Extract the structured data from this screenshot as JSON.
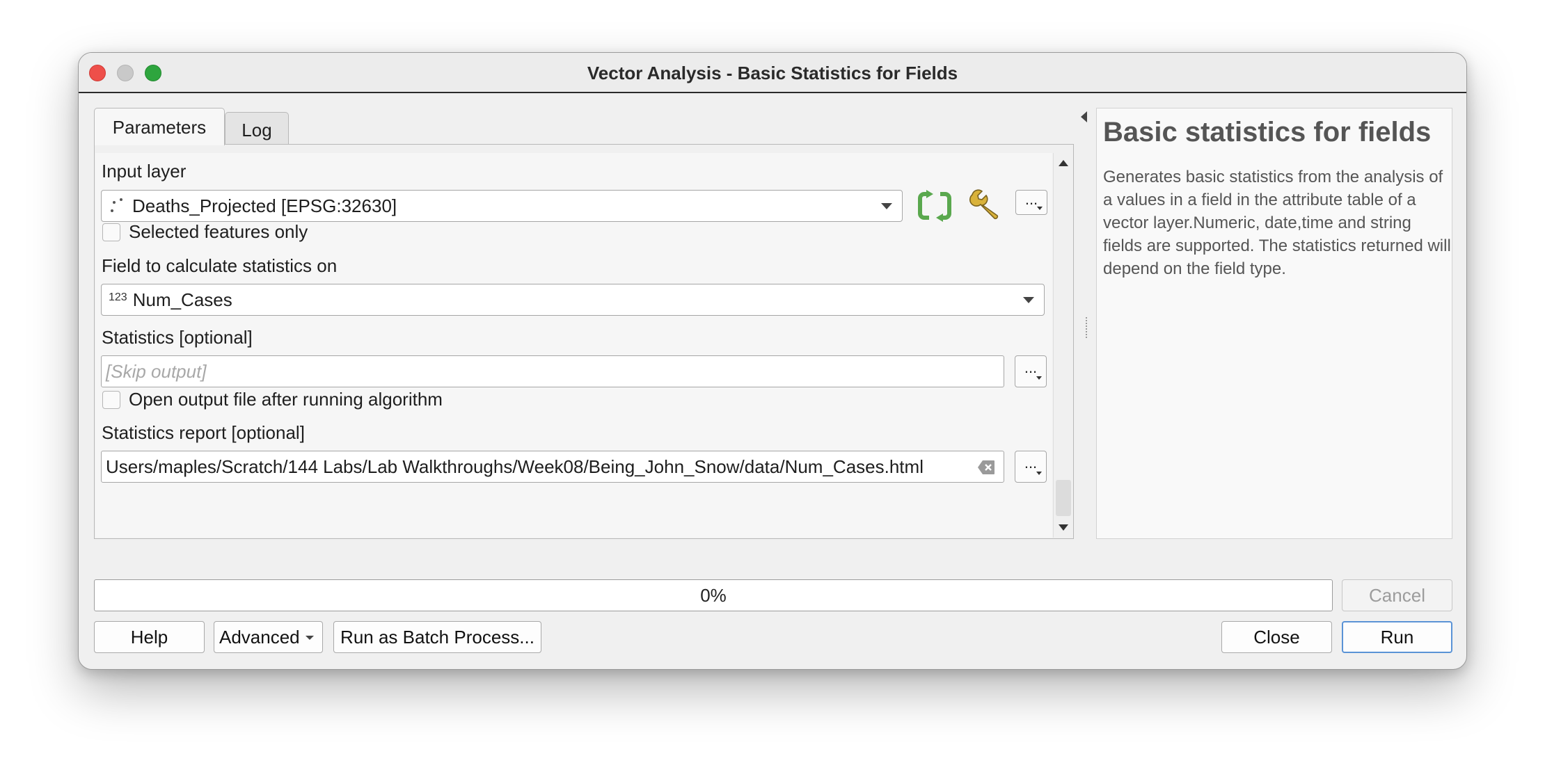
{
  "window": {
    "title": "Vector Analysis - Basic Statistics for Fields"
  },
  "tabs": [
    {
      "label": "Parameters"
    },
    {
      "label": "Log"
    }
  ],
  "form": {
    "input_layer": {
      "label": "Input layer",
      "value": "Deaths_Projected [EPSG:32630]",
      "icon": "point-layer-icon"
    },
    "selected_only": {
      "label": "Selected features only",
      "checked": false
    },
    "field": {
      "label": "Field to calculate statistics on",
      "type_badge": "123",
      "value": "Num_Cases"
    },
    "statistics": {
      "label": "Statistics [optional]",
      "placeholder": "[Skip output]"
    },
    "open_output": {
      "label": "Open output file after running algorithm",
      "checked": false
    },
    "report": {
      "label": "Statistics report [optional]",
      "value": "Users/maples/Scratch/144 Labs/Lab Walkthroughs/Week08/Being_John_Snow/data/Num_Cases.html"
    },
    "ellipsis": "..."
  },
  "help": {
    "title": "Basic statistics for fields",
    "body": "Generates basic statistics from the analysis of a values in a field in the attribute table of a vector layer.Numeric, date,time and string fields are supported. The statistics returned will depend on the field type."
  },
  "progress": {
    "text": "0%",
    "value": 0
  },
  "buttons": {
    "cancel": "Cancel",
    "help": "Help",
    "advanced": "Advanced",
    "batch": "Run as Batch Process...",
    "close": "Close",
    "run": "Run"
  },
  "colors": {
    "accent": "#5a93d6",
    "refresh_icon": "#5aa84e",
    "wrench_icon": "#d9b23a"
  }
}
